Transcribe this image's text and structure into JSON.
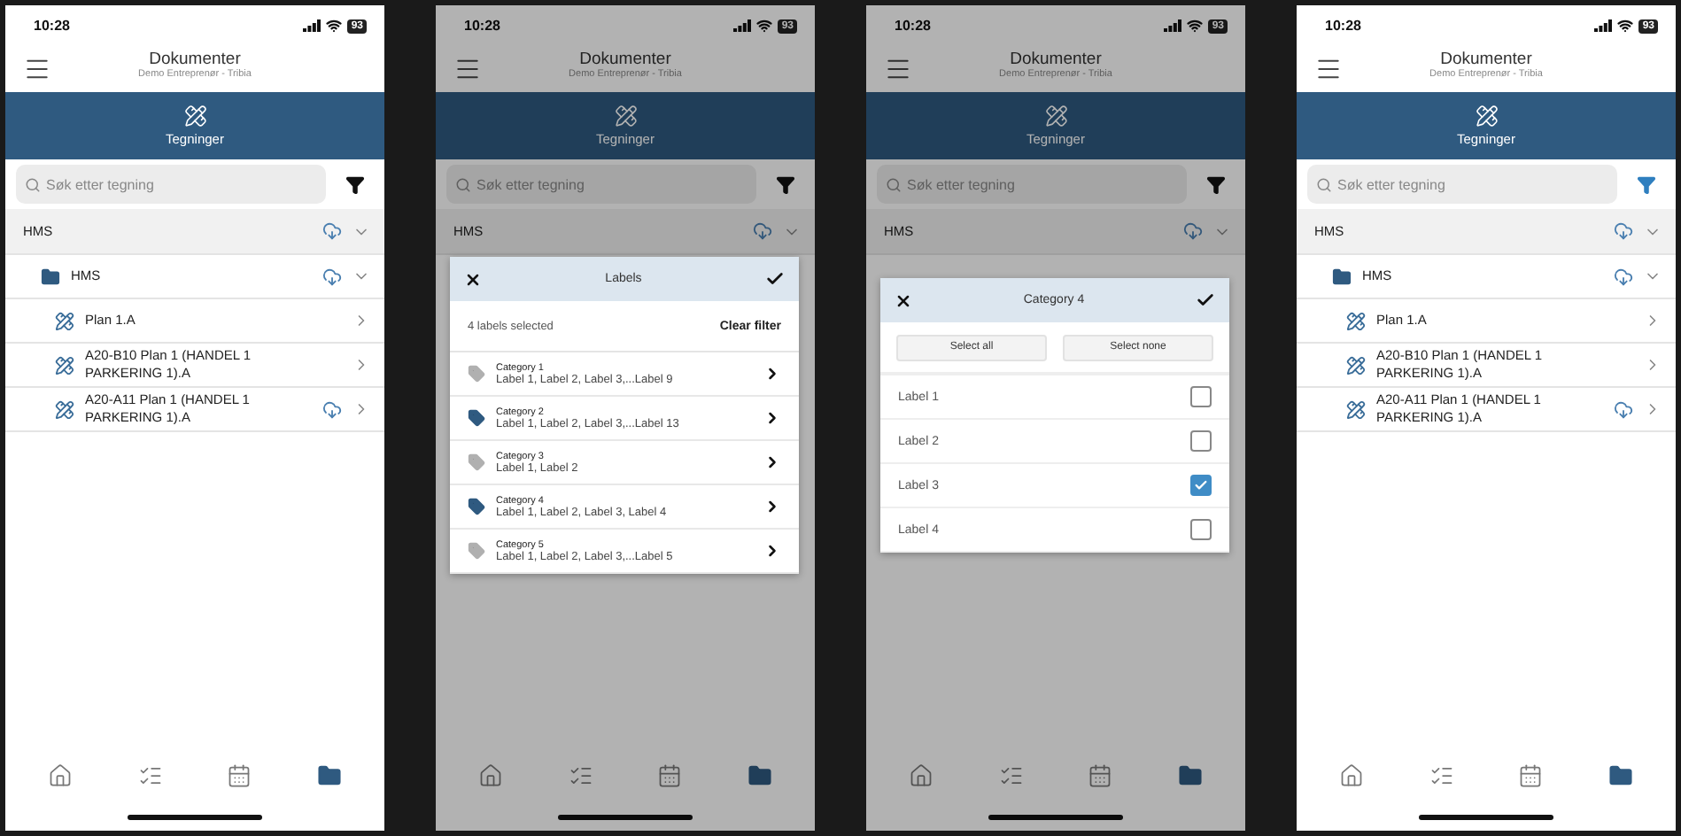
{
  "screens": [
    {
      "status": {
        "time": "10:28",
        "battery": "93"
      },
      "header": {
        "title": "Dokumenter",
        "subtitle": "Demo Entreprenør - Tribia"
      },
      "tab": {
        "label": "Tegninger"
      },
      "search": {
        "placeholder": "Søk etter tegning"
      },
      "filter_active": false,
      "dimmed": false,
      "tree": [
        {
          "kind": "section",
          "label": "HMS",
          "download": true
        },
        {
          "kind": "folder",
          "label": "HMS",
          "download": true
        },
        {
          "kind": "drawing",
          "label": "Plan 1.A",
          "download": false
        },
        {
          "kind": "drawing",
          "label": "A20-B10 Plan 1 (HANDEL 1 PARKERING 1).A",
          "download": false
        },
        {
          "kind": "drawing",
          "label": "A20-A11 Plan 1 (HANDEL 1 PARKERING 1).A",
          "download": true
        }
      ],
      "nav": [
        {
          "kind": "home",
          "selected": false
        },
        {
          "kind": "tasks",
          "selected": false
        },
        {
          "kind": "calendar",
          "selected": false
        },
        {
          "kind": "folder",
          "selected": true
        }
      ]
    },
    {
      "status": {
        "time": "10:28",
        "battery": "93"
      },
      "header": {
        "title": "Dokumenter",
        "subtitle": "Demo Entreprenør - Tribia"
      },
      "tab": {
        "label": "Tegninger"
      },
      "search": {
        "placeholder": "Søk etter tegning"
      },
      "filter_active": false,
      "dimmed": true,
      "tree": [
        {
          "kind": "section",
          "label": "HMS",
          "download": true
        }
      ],
      "nav": [
        {
          "kind": "home",
          "selected": false
        },
        {
          "kind": "tasks",
          "selected": false
        },
        {
          "kind": "calendar",
          "selected": false
        },
        {
          "kind": "folder",
          "selected": true
        }
      ],
      "dialog": {
        "kind": "labels",
        "title": "Labels",
        "summary": "4 labels selected",
        "clear_filter": "Clear filter",
        "categories": [
          {
            "name": "Category 1",
            "labels": "Label 1, Label 2, Label 3,...Label 9",
            "active": false
          },
          {
            "name": "Category 2",
            "labels": "Label 1, Label 2, Label 3,...Label 13",
            "active": true
          },
          {
            "name": "Category 3",
            "labels": "Label 1, Label 2",
            "active": false
          },
          {
            "name": "Category 4",
            "labels": "Label 1, Label 2, Label 3, Label 4",
            "active": true
          },
          {
            "name": "Category 5",
            "labels": "Label 1, Label 2, Label 3,...Label 5",
            "active": false
          }
        ]
      }
    },
    {
      "status": {
        "time": "10:28",
        "battery": "93"
      },
      "header": {
        "title": "Dokumenter",
        "subtitle": "Demo Entreprenør - Tribia"
      },
      "tab": {
        "label": "Tegninger"
      },
      "search": {
        "placeholder": "Søk etter tegning"
      },
      "filter_active": false,
      "dimmed": true,
      "tree": [
        {
          "kind": "section",
          "label": "HMS",
          "download": true
        }
      ],
      "nav": [
        {
          "kind": "home",
          "selected": false
        },
        {
          "kind": "tasks",
          "selected": false
        },
        {
          "kind": "calendar",
          "selected": false
        },
        {
          "kind": "folder",
          "selected": true
        }
      ],
      "dialog": {
        "kind": "category",
        "title": "Category 4",
        "buttons": [
          "Select all",
          "Select none"
        ],
        "options": [
          {
            "label": "Label 1",
            "checked": false
          },
          {
            "label": "Label 2",
            "checked": false
          },
          {
            "label": "Label 3",
            "checked": true
          },
          {
            "label": "Label 4",
            "checked": false
          }
        ]
      }
    },
    {
      "status": {
        "time": "10:28",
        "battery": "93"
      },
      "header": {
        "title": "Dokumenter",
        "subtitle": "Demo Entreprenør - Tribia"
      },
      "tab": {
        "label": "Tegninger"
      },
      "search": {
        "placeholder": "Søk etter tegning"
      },
      "filter_active": true,
      "dimmed": false,
      "tree": [
        {
          "kind": "section",
          "label": "HMS",
          "download": true
        },
        {
          "kind": "folder",
          "label": "HMS",
          "download": true
        },
        {
          "kind": "drawing",
          "label": "Plan 1.A",
          "download": false
        },
        {
          "kind": "drawing",
          "label": "A20-B10 Plan 1 (HANDEL 1 PARKERING 1).A",
          "download": false
        },
        {
          "kind": "drawing",
          "label": "A20-A11 Plan 1 (HANDEL 1 PARKERING 1).A",
          "download": true
        }
      ],
      "nav": [
        {
          "kind": "home",
          "selected": false
        },
        {
          "kind": "tasks",
          "selected": false
        },
        {
          "kind": "calendar",
          "selected": false
        },
        {
          "kind": "folder",
          "selected": true
        }
      ]
    }
  ]
}
